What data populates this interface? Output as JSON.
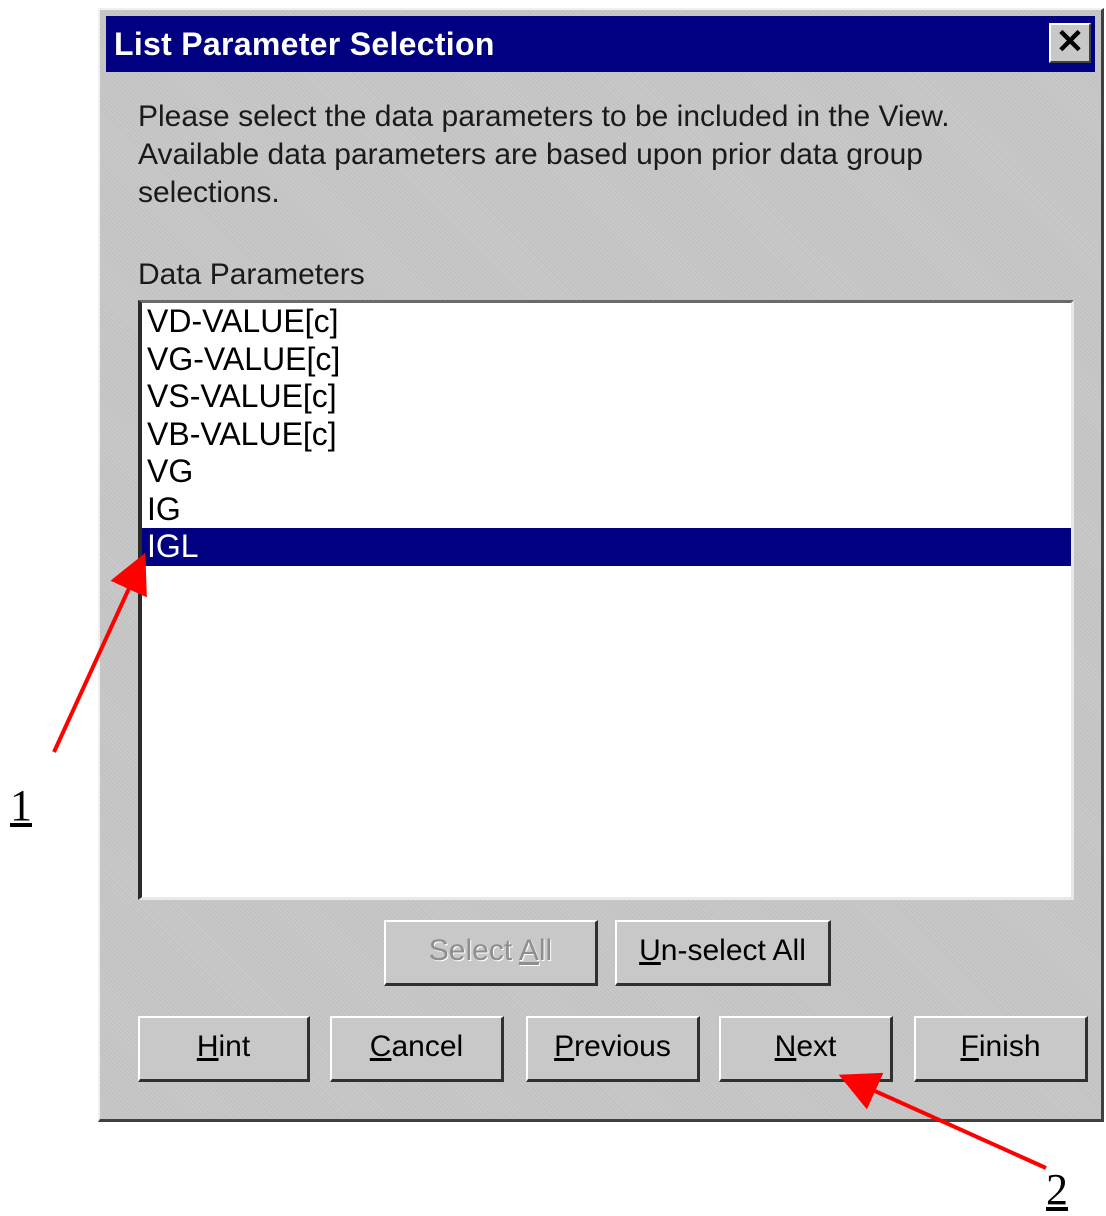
{
  "dialog": {
    "title": "List Parameter Selection",
    "close_glyph": "✕",
    "instructions": [
      "Please select the data parameters to be included in the View.",
      "Available data parameters are based upon prior data group",
      "selections."
    ],
    "list_label": "Data Parameters",
    "list_items": [
      "VD-VALUE[c]",
      "VG-VALUE[c]",
      "VS-VALUE[c]",
      "VB-VALUE[c]",
      "VG",
      "IG",
      "IGL"
    ],
    "selected_item": "IGL",
    "select_all": {
      "mnemonic": "",
      "rest_before": "Select ",
      "mn": "A",
      "rest": "ll",
      "enabled": false
    },
    "unselect_all": {
      "mn": "U",
      "rest": "n-select All",
      "enabled": true
    },
    "buttons": {
      "hint": {
        "mn": "H",
        "rest": "int"
      },
      "cancel": {
        "mn": "C",
        "rest": "ancel"
      },
      "previous": {
        "mn": "P",
        "rest": "revious"
      },
      "next": {
        "mn": "N",
        "rest": "ext"
      },
      "finish": {
        "mn": "F",
        "rest": "inish"
      }
    }
  },
  "annotations": {
    "callout_1": "1",
    "callout_2": "2",
    "arrow_color": "#ff0000"
  },
  "colors": {
    "titlebar": "#000080",
    "selection": "#000080",
    "dialog_bg": "#c8c8c8"
  }
}
